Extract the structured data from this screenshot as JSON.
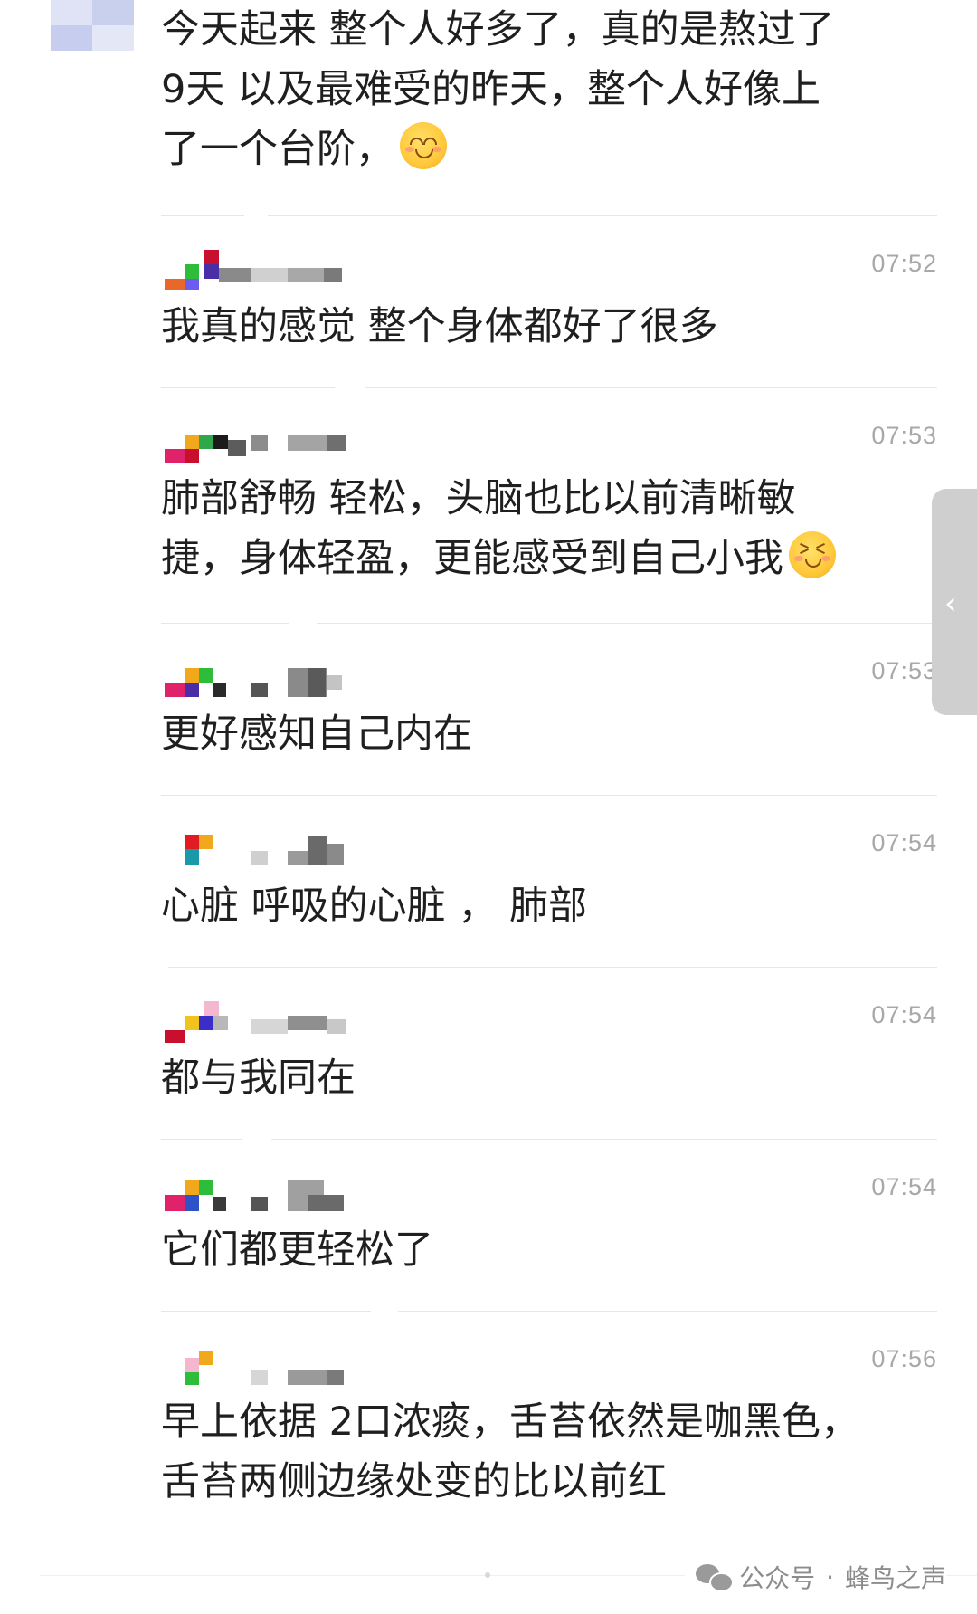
{
  "chat": {
    "messages": [
      {
        "time": "",
        "lines": [
          "今天起来 整个人好多了，真的是熬过了",
          "9天 以及最难受的昨天，整个人好像上",
          "了一个台阶，"
        ],
        "emoji": "smiling-blush-emoji"
      },
      {
        "time": "07:52",
        "lines": [
          "我真的感觉 整个身体都好了很多"
        ]
      },
      {
        "time": "07:53",
        "lines": [
          "肺部舒畅 轻松，头脑也比以前清晰敏",
          "捷，身体轻盈，更能感受到自己小我"
        ],
        "emoji": "grinning-squint-emoji"
      },
      {
        "time": "07:53",
        "lines": [
          "更好感知自己内在"
        ]
      },
      {
        "time": "07:54",
        "lines": [
          "心脏 呼吸的心脏 ， 肺部"
        ]
      },
      {
        "time": "07:54",
        "lines": [
          "都与我同在"
        ]
      },
      {
        "time": "07:54",
        "lines": [
          "它们都更轻松了"
        ]
      },
      {
        "time": "07:56",
        "lines": [
          "早上依据 2口浓痰，舌苔依然是咖黑色，",
          "舌苔两侧边缘处变的比以前红"
        ]
      }
    ]
  },
  "side_handle": {
    "icon": "chevron-left-icon",
    "glyph": "‹"
  },
  "watermark": {
    "icon": "wechat-icon",
    "source": "公众号",
    "separator": "·",
    "account": "蜂鸟之声"
  }
}
